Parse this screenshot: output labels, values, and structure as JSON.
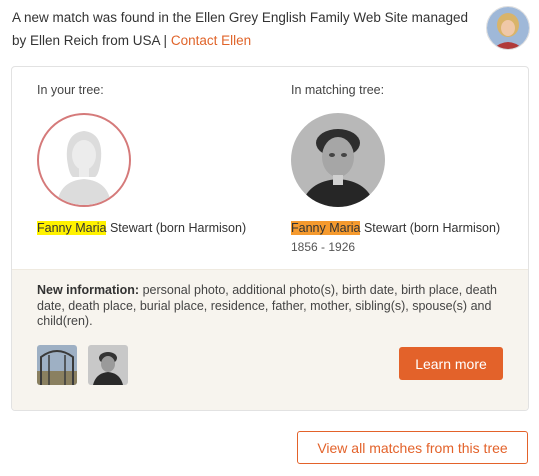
{
  "header": {
    "message": "A new match was found in the Ellen Grey English Family Web Site managed by Ellen Reich from USA | ",
    "contact_link": "Contact Ellen"
  },
  "left": {
    "label": "In your tree:",
    "name_highlight": "Fanny Maria",
    "name_rest": " Stewart (born Harmison)"
  },
  "right": {
    "label": "In matching tree:",
    "name_highlight": "Fanny Maria",
    "name_rest": " Stewart (born Harmison)",
    "dates": "1856 - 1926"
  },
  "info": {
    "title": "New information:",
    "text": " personal photo, additional photo(s), birth date, birth place, death date, death place, burial place, residence, father, mother, sibling(s), spouse(s) and child(ren)."
  },
  "buttons": {
    "learn_more": "Learn more",
    "view_all": "View all matches from this tree"
  },
  "colors": {
    "accent": "#e3622a",
    "highlight_yellow": "#fff200",
    "highlight_orange": "#f59a2e",
    "empty_ring": "#d57a7a"
  }
}
